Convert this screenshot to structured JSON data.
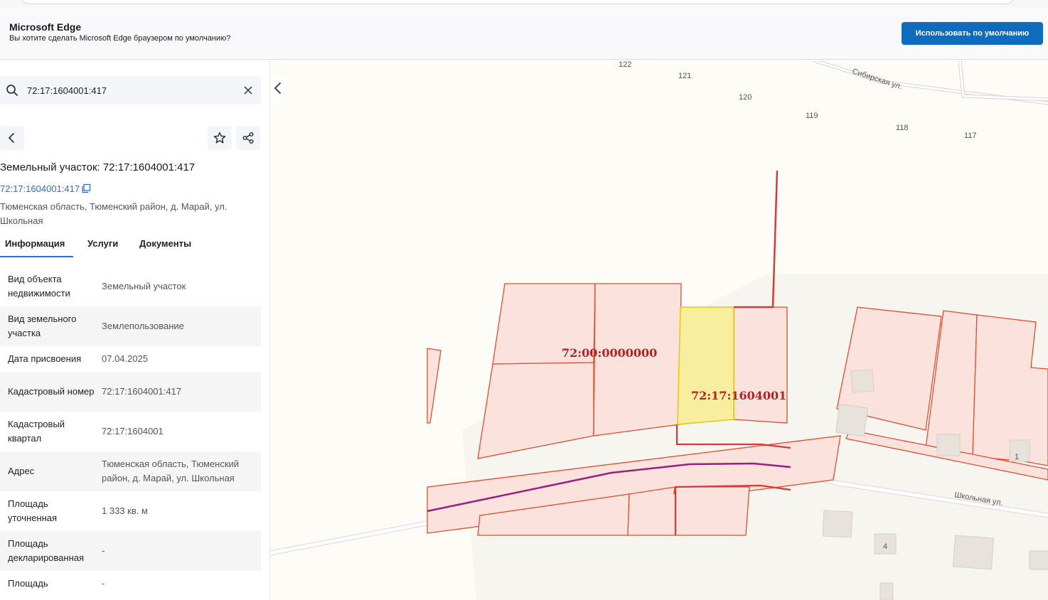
{
  "banner": {
    "title": "Microsoft Edge",
    "subtitle": "Вы хотите сделать Microsoft Edge браузером по умолчанию?",
    "button": "Использовать по умолчанию"
  },
  "search": {
    "value": "72:17:1604001:417"
  },
  "card": {
    "title": "Земельный участок: 72:17:1604001:417",
    "cadnum_link": "72:17:1604001:417",
    "address": "Тюменская область, Тюменский район, д. Марай, ул. Школьная"
  },
  "tabs": [
    {
      "label": "Информация"
    },
    {
      "label": "Услуги"
    },
    {
      "label": "Документы"
    }
  ],
  "rows": [
    {
      "label": "Вид объекта недвижимости",
      "value": "Земельный участок"
    },
    {
      "label": "Вид земельного участка",
      "value": "Землепользование"
    },
    {
      "label": "Дата присвоения",
      "value": "07.04.2025"
    },
    {
      "label": "Кадастровый номер",
      "value": "72:17:1604001:417"
    },
    {
      "label": "Кадастровый квартал",
      "value": "72:17:1604001"
    },
    {
      "label": "Адрес",
      "value": "Тюменская область, Тюменский район, д. Марай, ул. Школьная"
    },
    {
      "label": "Площадь уточненная",
      "value": "1 333 кв. м"
    },
    {
      "label": "Площадь декларированная",
      "value": "-"
    },
    {
      "label": "Площадь",
      "value": "-"
    }
  ],
  "map": {
    "house_numbers": [
      "122",
      "121",
      "120",
      "119",
      "118",
      "117",
      "1",
      "4"
    ],
    "streets": [
      "Сибирская ул.",
      "Школьная ул."
    ],
    "labels": [
      "72:00:0000000",
      "72:17:1604001"
    ],
    "colors": {
      "parcel_stroke": "#e0502f",
      "parcel_fill": "#fbe2dc",
      "selected_fill": "#f8ee9f",
      "selected_stroke": "#e8c800",
      "label_color": "#b22222",
      "road_line": "#9b1f7f"
    }
  }
}
